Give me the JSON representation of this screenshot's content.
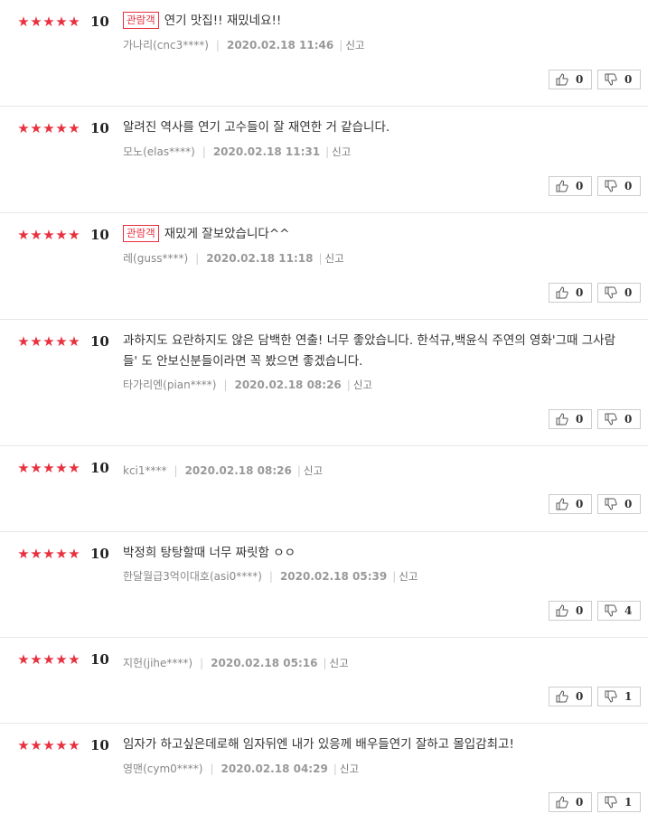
{
  "ui": {
    "badge_label": "관람객",
    "report_label": "신고",
    "star_glyph": "★",
    "accent_color": "#e8303f"
  },
  "reviews": [
    {
      "score": "10",
      "audience": true,
      "text": "연기 맛집!! 재밌네요!!",
      "author": "가나리(cnc3****)",
      "date": "2020.02.18 11:46",
      "likes": "0",
      "dislikes": "0"
    },
    {
      "score": "10",
      "audience": false,
      "text": "알려진 역사를 연기 고수들이 잘 재연한 거 같습니다.",
      "author": "모노(elas****)",
      "date": "2020.02.18 11:31",
      "likes": "0",
      "dislikes": "0"
    },
    {
      "score": "10",
      "audience": true,
      "text": "재밌게 잘보았습니다^^",
      "author": "레(guss****)",
      "date": "2020.02.18 11:18",
      "likes": "0",
      "dislikes": "0"
    },
    {
      "score": "10",
      "audience": false,
      "text": "과하지도 요란하지도 않은 담백한 연출! 너무 좋았습니다. 한석규,백윤식 주연의 영화'그때 그사람들' 도 안보신분들이라면 꼭 봤으면 좋겠습니다.",
      "author": "타가리엔(pian****)",
      "date": "2020.02.18 08:26",
      "likes": "0",
      "dislikes": "0"
    },
    {
      "score": "10",
      "audience": false,
      "text": "",
      "author": "kci1****",
      "date": "2020.02.18 08:26",
      "likes": "0",
      "dislikes": "0"
    },
    {
      "score": "10",
      "audience": false,
      "text": "박정희 탕탕할때 너무 짜릿함 ㅇㅇ",
      "author": "한달월급3억이대호(asi0****)",
      "date": "2020.02.18 05:39",
      "likes": "0",
      "dislikes": "4"
    },
    {
      "score": "10",
      "audience": false,
      "text": "",
      "author": "지헌(jihe****)",
      "date": "2020.02.18 05:16",
      "likes": "0",
      "dislikes": "1"
    },
    {
      "score": "10",
      "audience": false,
      "text": "임자가 하고싶은데로해 임자뒤엔 내가 있응께 배우들연기 잘하고 몰입감최고!",
      "author": "영맨(cym0****)",
      "date": "2020.02.18 04:29",
      "likes": "0",
      "dislikes": "1"
    }
  ]
}
